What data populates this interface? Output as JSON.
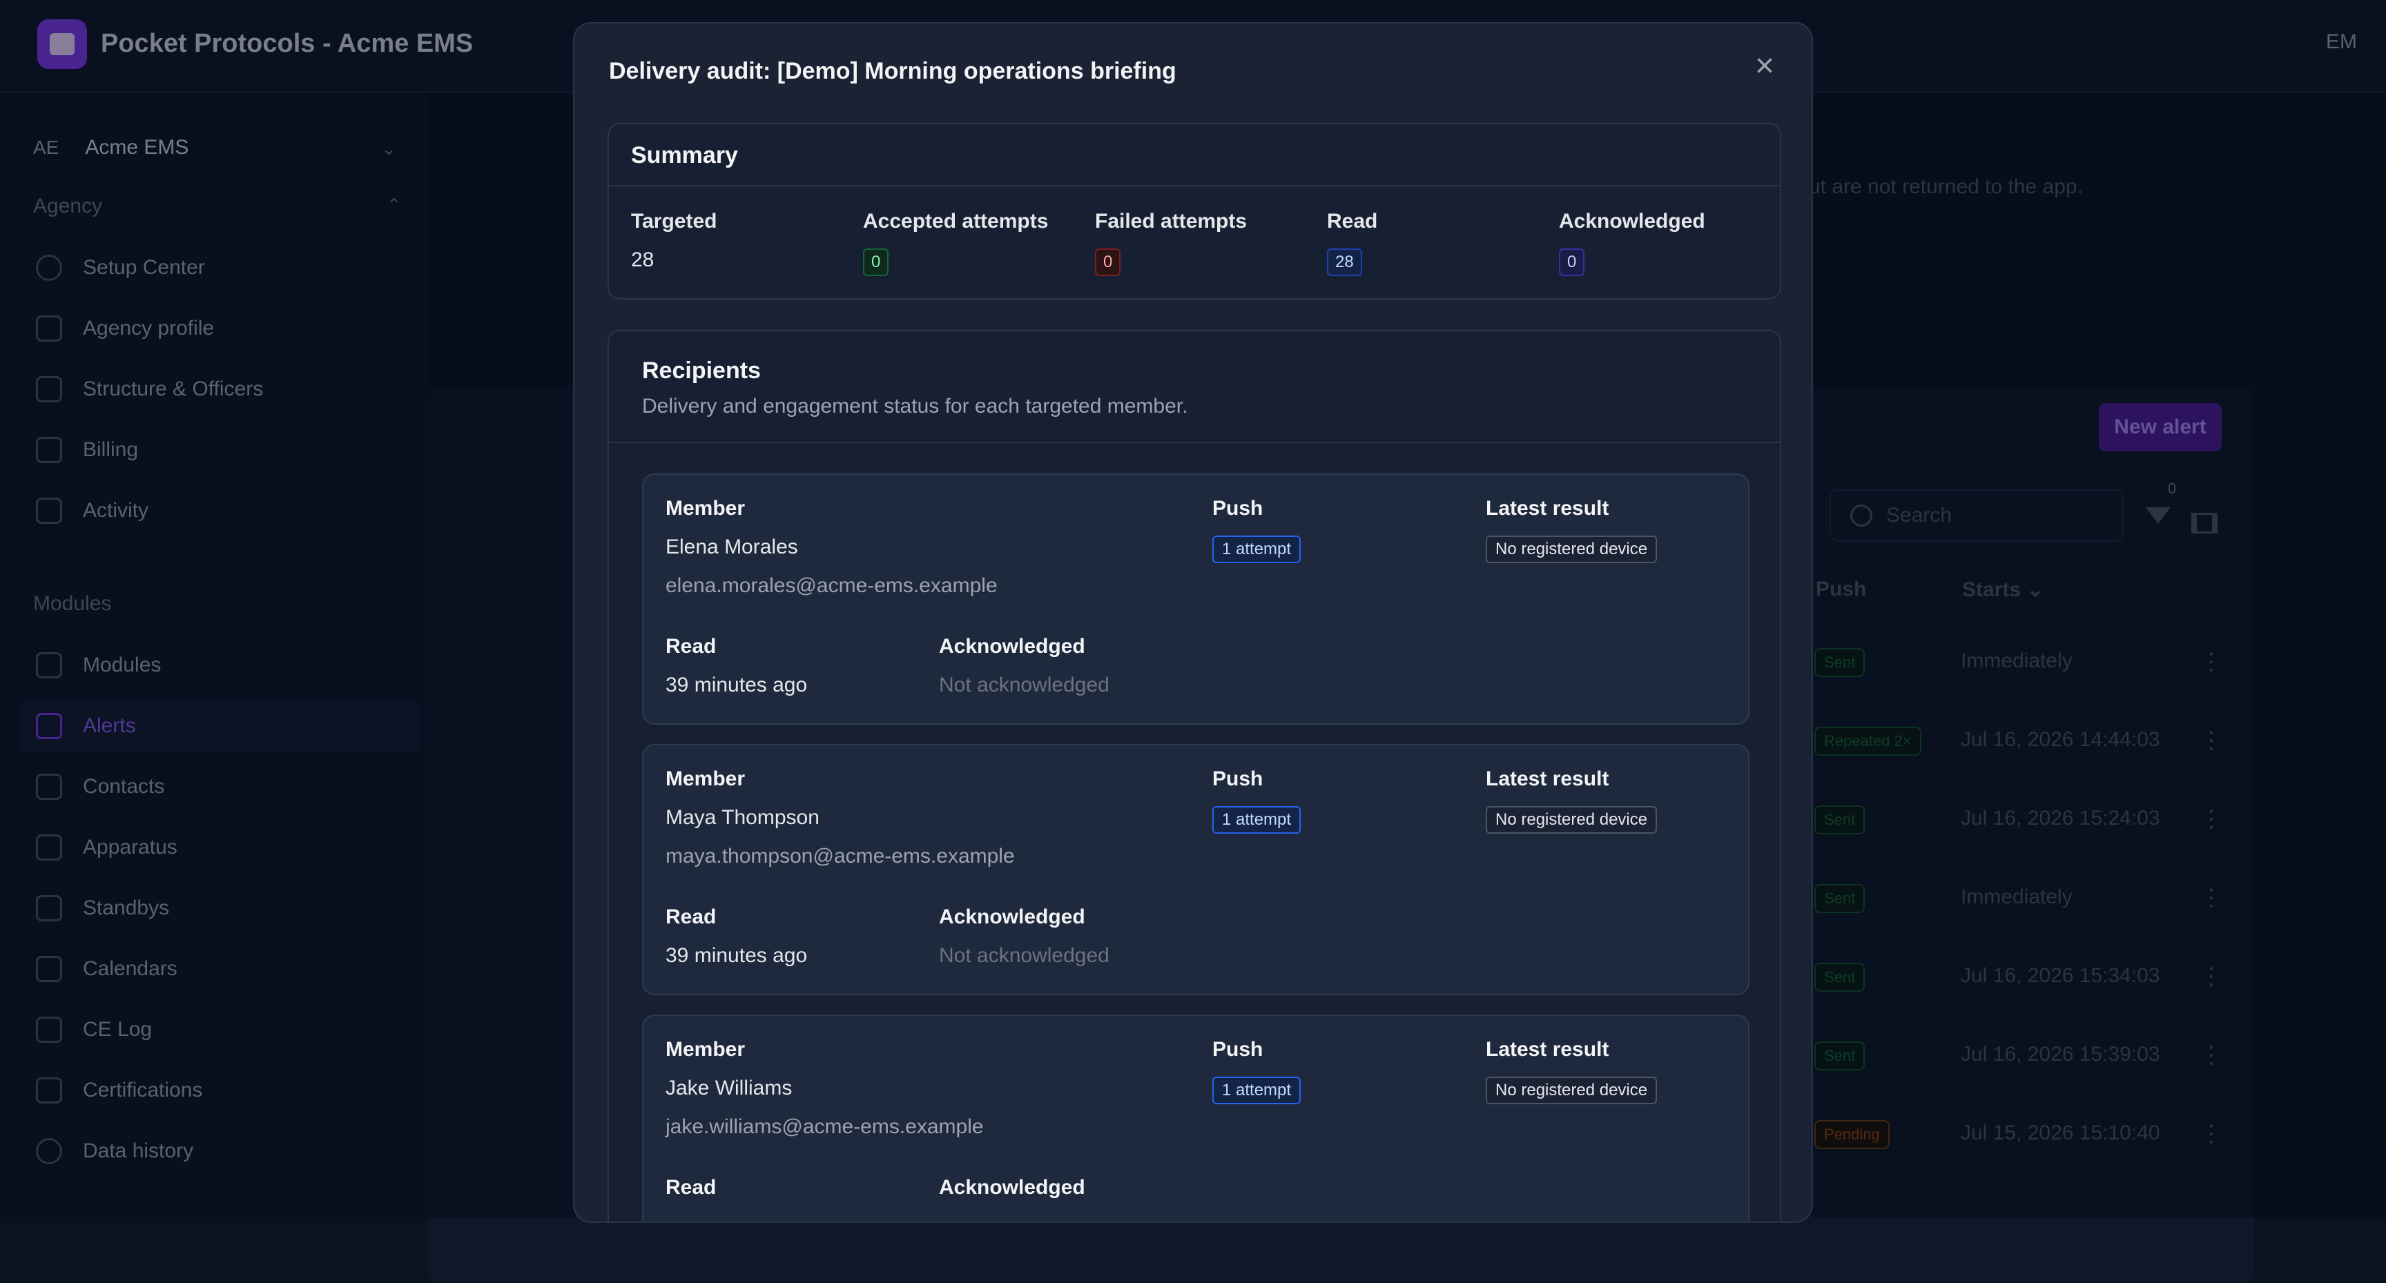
{
  "app": {
    "title": "Pocket Protocols - Acme EMS",
    "user_initials": "EM"
  },
  "sidebar": {
    "org": {
      "abbr": "AE",
      "name": "Acme EMS"
    },
    "agency_header": "Agency",
    "agency_items": [
      {
        "label": "Setup Center",
        "icon": "check-circle-icon"
      },
      {
        "label": "Agency profile",
        "icon": "building-icon"
      },
      {
        "label": "Structure & Officers",
        "icon": "buildings-icon"
      },
      {
        "label": "Billing",
        "icon": "credit-card-icon"
      },
      {
        "label": "Activity",
        "icon": "clipboard-icon"
      }
    ],
    "modules_header": "Modules",
    "module_items": [
      {
        "label": "Modules",
        "icon": "grid-icon"
      },
      {
        "label": "Alerts",
        "icon": "megaphone-icon",
        "active": true
      },
      {
        "label": "Contacts",
        "icon": "id-card-icon"
      },
      {
        "label": "Apparatus",
        "icon": "truck-icon"
      },
      {
        "label": "Standbys",
        "icon": "calendar-icon"
      },
      {
        "label": "Calendars",
        "icon": "calendar-icon"
      },
      {
        "label": "CE Log",
        "icon": "clipboard-icon"
      },
      {
        "label": "Certifications",
        "icon": "clipboard-icon"
      },
      {
        "label": "Data history",
        "icon": "clock-icon"
      }
    ]
  },
  "background": {
    "info_text": "ut are not returned to the app.",
    "new_alert_label": "New alert",
    "search_placeholder": "Search",
    "filter_count": "0",
    "columns": {
      "push": "Push",
      "starts": "Starts"
    },
    "rows": [
      {
        "push": "Sent",
        "starts": "Immediately",
        "status": "sent"
      },
      {
        "push": "Repeated 2×",
        "starts": "Jul 16, 2026 14:44:03",
        "status": "sent"
      },
      {
        "push": "Sent",
        "starts": "Jul 16, 2026 15:24:03",
        "status": "sent"
      },
      {
        "push": "Sent",
        "starts": "Immediately",
        "status": "sent"
      },
      {
        "push": "Sent",
        "starts": "Jul 16, 2026 15:34:03",
        "status": "sent"
      },
      {
        "push": "Sent",
        "starts": "Jul 16, 2026 15:39:03",
        "status": "sent"
      },
      {
        "push": "Pending",
        "starts": "Jul 15, 2026 15:10:40",
        "status": "pending"
      }
    ]
  },
  "modal": {
    "title": "Delivery audit: [Demo] Morning operations briefing",
    "summary": {
      "heading": "Summary",
      "targeted_label": "Targeted",
      "targeted": "28",
      "accepted_label": "Accepted attempts",
      "accepted": "0",
      "failed_label": "Failed attempts",
      "failed": "0",
      "read_label": "Read",
      "read": "28",
      "ack_label": "Acknowledged",
      "ack": "0"
    },
    "recipients": {
      "heading": "Recipients",
      "subtitle": "Delivery and engagement status for each targeted member.",
      "labels": {
        "member": "Member",
        "push": "Push",
        "latest_result": "Latest result",
        "read": "Read",
        "acknowledged": "Acknowledged"
      },
      "items": [
        {
          "name": "Elena Morales",
          "email": "elena.morales@acme-ems.example",
          "push": "1 attempt",
          "result": "No registered device",
          "read": "39 minutes ago",
          "ack": "Not acknowledged"
        },
        {
          "name": "Maya Thompson",
          "email": "maya.thompson@acme-ems.example",
          "push": "1 attempt",
          "result": "No registered device",
          "read": "39 minutes ago",
          "ack": "Not acknowledged"
        },
        {
          "name": "Jake Williams",
          "email": "jake.williams@acme-ems.example",
          "push": "1 attempt",
          "result": "No registered device",
          "read": "",
          "ack": ""
        }
      ]
    }
  }
}
